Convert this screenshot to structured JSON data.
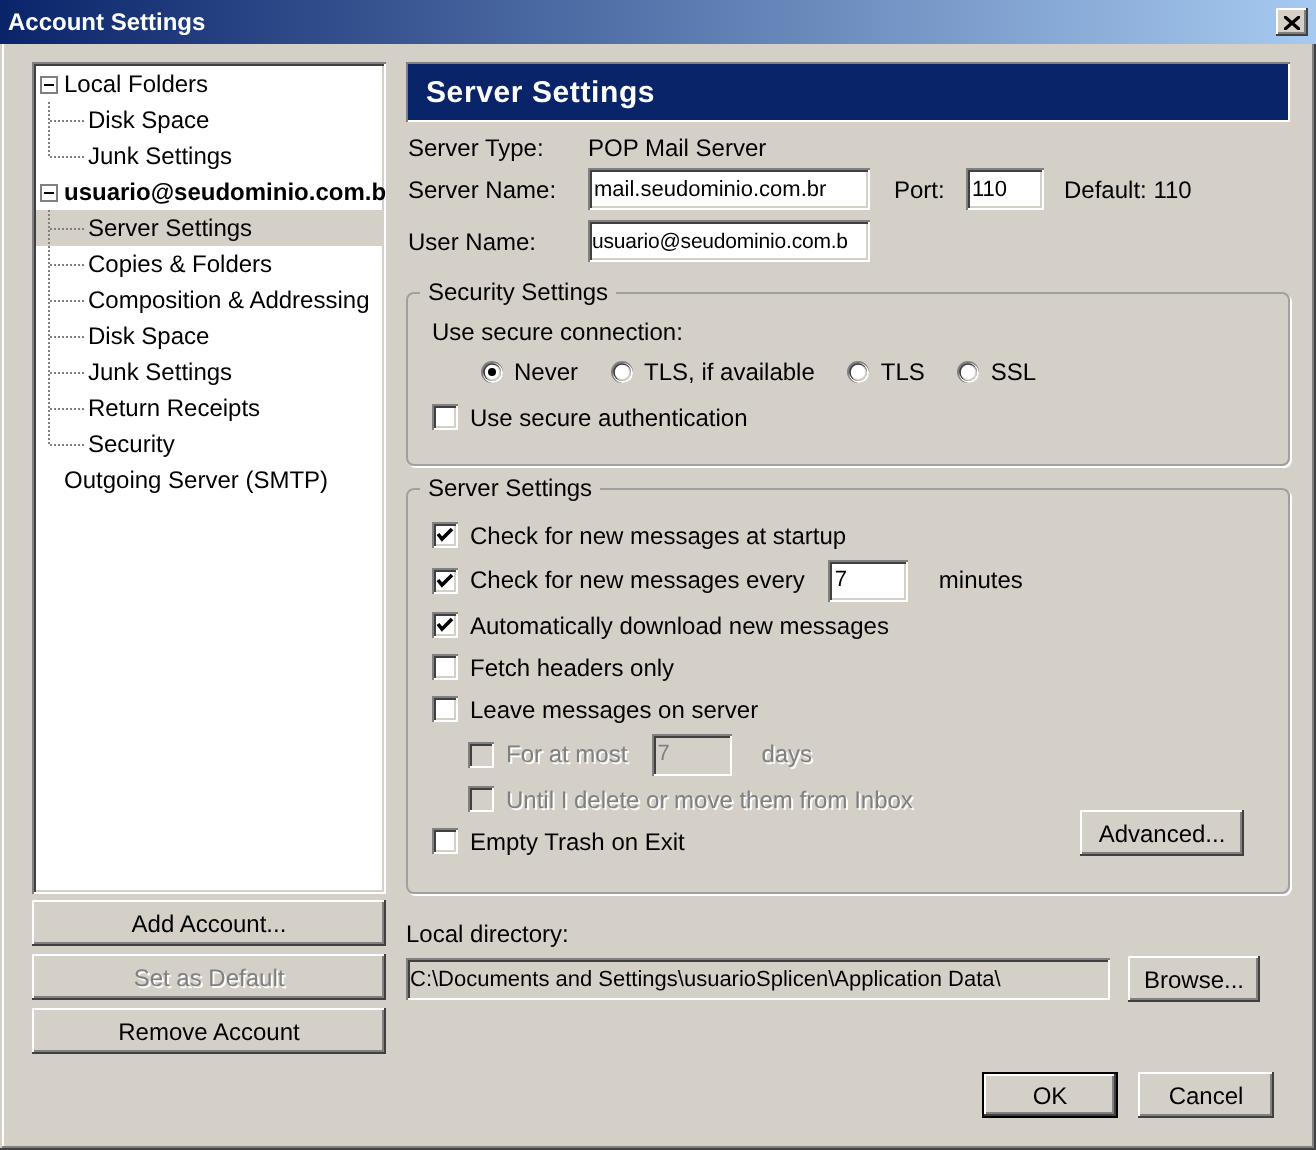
{
  "window": {
    "title": "Account Settings"
  },
  "tree": [
    {
      "kind": "local",
      "label": "Local Folders",
      "expanded": true,
      "selected": false,
      "children": [
        {
          "label": "Disk Space",
          "selected": false
        },
        {
          "label": "Junk Settings",
          "selected": false
        }
      ]
    },
    {
      "kind": "account",
      "label": "usuario@seudominio.com.b",
      "expanded": true,
      "selected": false,
      "children": [
        {
          "label": "Server Settings",
          "selected": true
        },
        {
          "label": "Copies & Folders",
          "selected": false
        },
        {
          "label": "Composition & Addressing",
          "selected": false
        },
        {
          "label": "Disk Space",
          "selected": false
        },
        {
          "label": "Junk Settings",
          "selected": false
        },
        {
          "label": "Return Receipts",
          "selected": false
        },
        {
          "label": "Security",
          "selected": false
        }
      ]
    },
    {
      "kind": "smtp",
      "label": "Outgoing Server (SMTP)",
      "selected": false
    }
  ],
  "account_buttons": [
    {
      "label": "Add Account...",
      "disabled": false
    },
    {
      "label": "Set as Default",
      "disabled": true
    },
    {
      "label": "Remove Account",
      "disabled": false
    }
  ],
  "panel": {
    "title": "Server Settings",
    "server_type": {
      "label": "Server Type:",
      "value": "POP Mail Server"
    },
    "server_name": {
      "label": "Server Name:",
      "value": "mail.seudominio.com.br"
    },
    "port": {
      "label": "Port:",
      "value": "110",
      "default": "Default: 110"
    },
    "user_name": {
      "label": "User Name:",
      "value": "usuario@seudominio.com.b"
    },
    "security": {
      "title": "Security Settings",
      "prompt": "Use secure connection:",
      "options": [
        {
          "label": "Never",
          "selected": true
        },
        {
          "label": "TLS, if available",
          "selected": false
        },
        {
          "label": "TLS",
          "selected": false
        },
        {
          "label": "SSL",
          "selected": false
        }
      ],
      "secure_auth": {
        "label": "Use secure authentication",
        "checked": false
      }
    },
    "server_settings": {
      "title": "Server Settings",
      "options": [
        {
          "kind": "check",
          "label": "Check for new messages at startup",
          "checked": true,
          "disabled": false
        },
        {
          "kind": "check_field",
          "label": "Check for new messages every",
          "checked": true,
          "disabled": false,
          "value": "7",
          "unit": "minutes"
        },
        {
          "kind": "check",
          "label": "Automatically download new messages",
          "checked": true,
          "disabled": false
        },
        {
          "kind": "check",
          "label": "Fetch headers only",
          "checked": false,
          "disabled": false
        },
        {
          "kind": "check",
          "label": "Leave messages on server",
          "checked": false,
          "disabled": false,
          "children": [
            {
              "kind": "check_field",
              "label": "For at most",
              "checked": false,
              "disabled": true,
              "value": "7",
              "unit": "days"
            },
            {
              "kind": "check",
              "label": "Until I delete or move them from Inbox",
              "checked": false,
              "disabled": true
            }
          ]
        },
        {
          "kind": "check",
          "label": "Empty Trash on Exit",
          "checked": false,
          "disabled": false
        }
      ],
      "advanced_button": "Advanced..."
    },
    "local_directory": {
      "label": "Local directory:",
      "value": "C:\\Documents and Settings\\usuarioSplicen\\Application Data\\",
      "readonly": true,
      "browse_button": "Browse..."
    }
  },
  "dialog_buttons": [
    {
      "label": "OK",
      "default": true
    },
    {
      "label": "Cancel",
      "default": false
    }
  ]
}
